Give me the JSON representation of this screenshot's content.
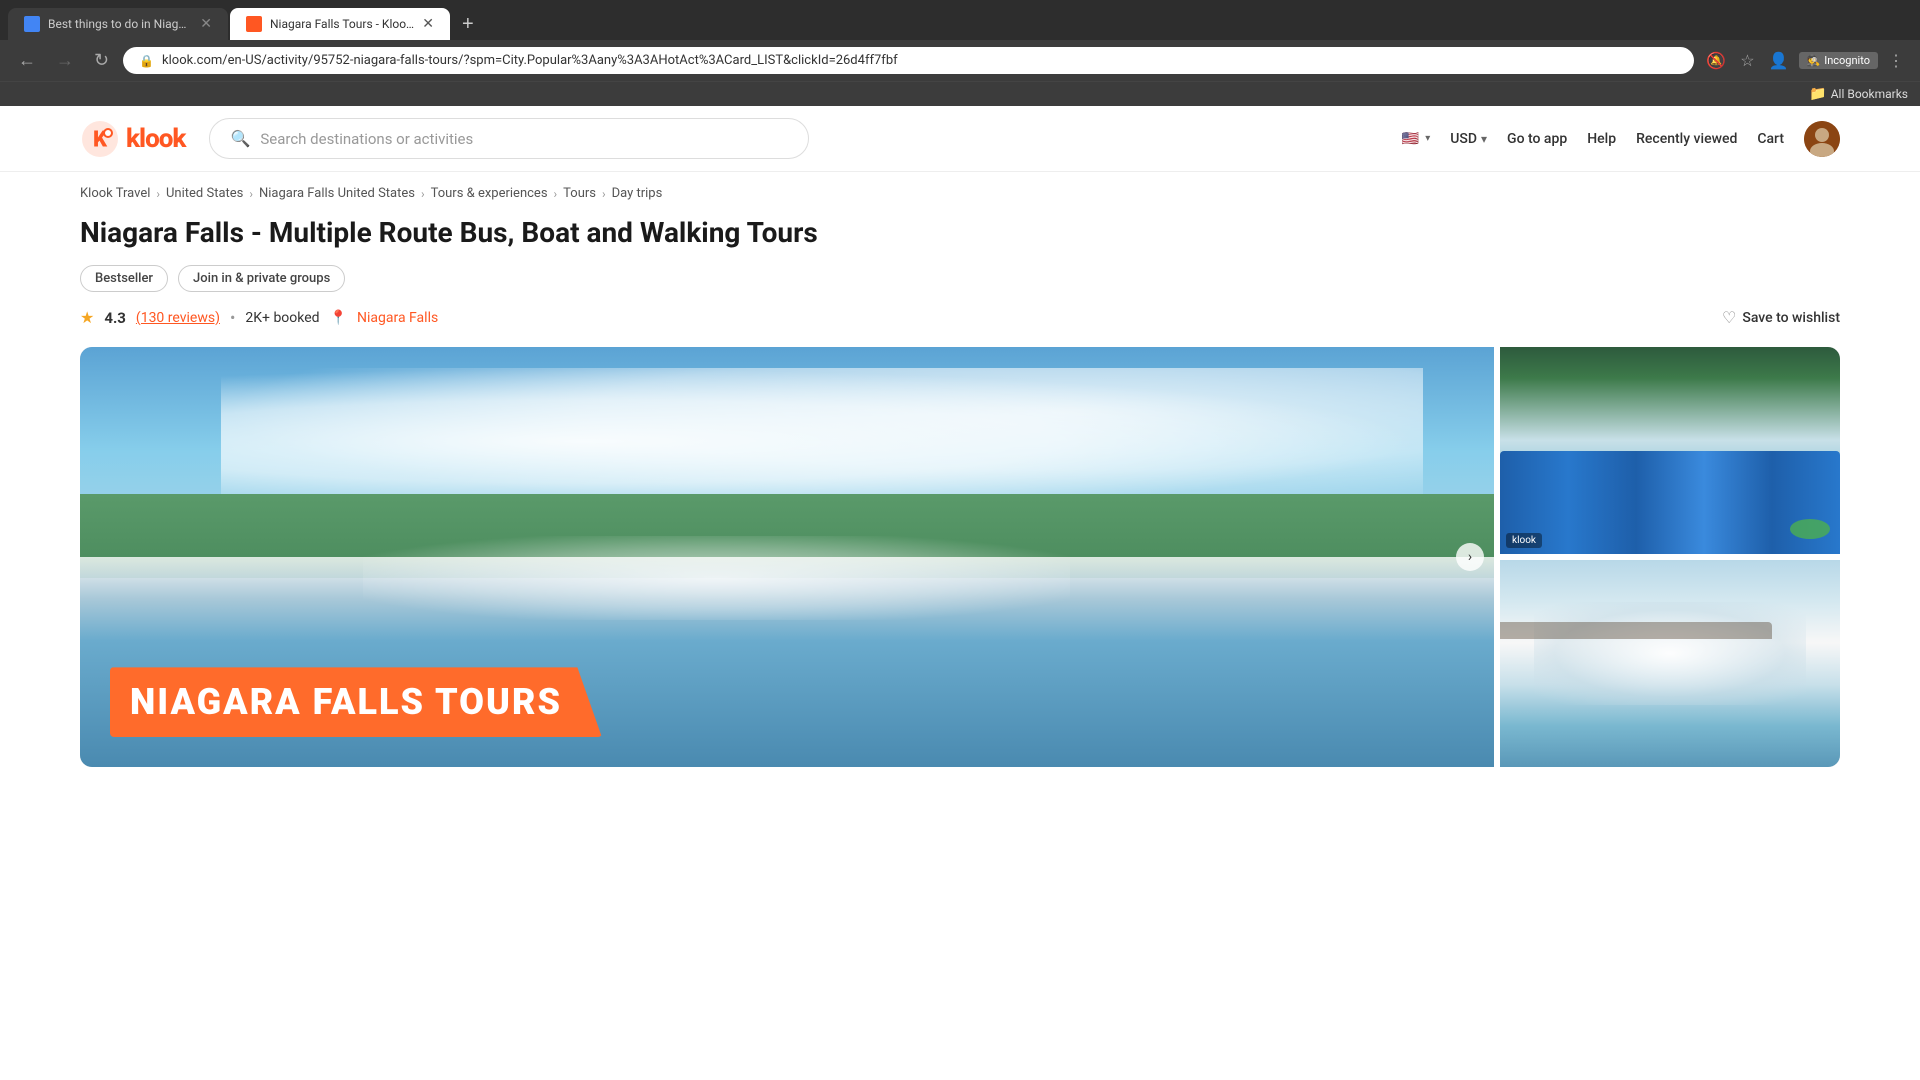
{
  "browser": {
    "tabs": [
      {
        "id": "tab1",
        "title": "Best things to do in Niagara Fa...",
        "favicon_color": "#4285f4",
        "active": false
      },
      {
        "id": "tab2",
        "title": "Niagara Falls Tours - Klook Uni...",
        "favicon_color": "#ff5722",
        "active": true
      }
    ],
    "new_tab_label": "+",
    "url": "klook.com/en-US/activity/95752-niagara-falls-tours/?spm=City.Popular%3Aany%3A3AHotAct%3ACard_LIST&clickId=26d4ff7fbf",
    "nav": {
      "back": "←",
      "forward": "→",
      "reload": "↻"
    },
    "toolbar_icons": {
      "eye_slash": "👁",
      "star": "☆",
      "profile": "👤",
      "menu": "⋮"
    },
    "incognito_label": "Incognito",
    "bookmarks_bar_label": "All Bookmarks"
  },
  "header": {
    "logo_text": "klook",
    "search_placeholder": "Search destinations or activities",
    "lang_label": "🇺🇸",
    "currency_label": "USD",
    "currency_arrow": "▾",
    "go_to_app_label": "Go to app",
    "help_label": "Help",
    "recently_viewed_label": "Recently viewed",
    "cart_label": "Cart"
  },
  "breadcrumb": {
    "items": [
      {
        "label": "Klook Travel",
        "href": "#"
      },
      {
        "label": "United States",
        "href": "#"
      },
      {
        "label": "Niagara Falls United States",
        "href": "#"
      },
      {
        "label": "Tours & experiences",
        "href": "#"
      },
      {
        "label": "Tours",
        "href": "#"
      },
      {
        "label": "Day trips",
        "href": "#"
      }
    ],
    "separator": "›"
  },
  "product": {
    "title": "Niagara Falls - Multiple Route Bus, Boat and Walking Tours",
    "tags": [
      {
        "label": "Bestseller"
      },
      {
        "label": "Join in & private groups"
      }
    ],
    "rating": {
      "score": "4.3",
      "reviews": "(130 reviews)",
      "star": "★"
    },
    "bookings": "2K+ booked",
    "location": "Niagara Falls",
    "wishlist_label": "Save to wishlist",
    "gallery_banner": "NIAGARA FALLS TOURS",
    "klook_watermark": "klook"
  }
}
